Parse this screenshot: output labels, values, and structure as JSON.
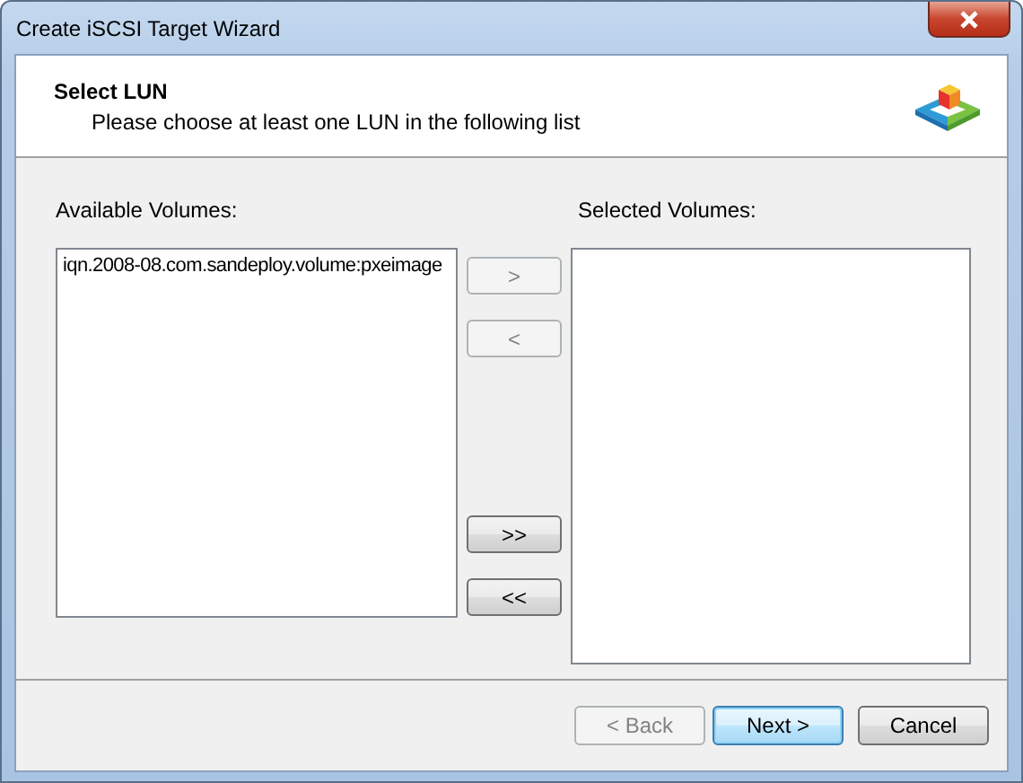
{
  "window": {
    "title": "Create iSCSI Target Wizard"
  },
  "header": {
    "title": "Select LUN",
    "subtitle": "Please choose at least one LUN in the following list"
  },
  "available": {
    "label": "Available Volumes:",
    "items": [
      {
        "text": "iqn.2008-08.com.sandeploy.volume:pxeimage",
        "selected": false
      }
    ]
  },
  "move_buttons": [
    {
      "label": ">",
      "disabled": true
    },
    {
      "label": "<",
      "disabled": true
    },
    {
      "label": ">>",
      "disabled": false
    },
    {
      "label": "<<",
      "disabled": false
    }
  ],
  "selected": {
    "label": "Selected Volumes:"
  },
  "buttons": [
    {
      "label": "< Back",
      "disabled": true,
      "default": false
    },
    {
      "label": "Next >",
      "disabled": false,
      "default": true
    },
    {
      "label": "Cancel",
      "disabled": false,
      "default": false
    }
  ]
}
